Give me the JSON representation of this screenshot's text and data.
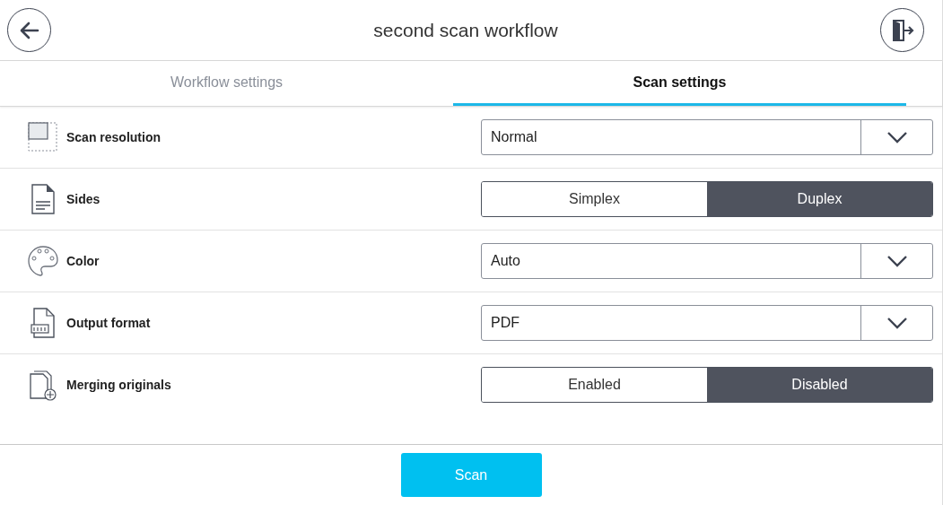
{
  "header": {
    "title": "second scan workflow"
  },
  "tabs": [
    {
      "label": "Workflow settings",
      "selected": false
    },
    {
      "label": "Scan settings",
      "selected": true
    }
  ],
  "settings": [
    {
      "label": "Scan resolution",
      "kind": "dropdown",
      "value": "Normal"
    },
    {
      "label": "Sides",
      "kind": "toggle",
      "options": [
        {
          "label": "Simplex",
          "selected": false
        },
        {
          "label": "Duplex",
          "selected": true
        }
      ]
    },
    {
      "label": "Color",
      "kind": "dropdown",
      "value": "Auto"
    },
    {
      "label": "Output format",
      "kind": "dropdown",
      "value": "PDF"
    },
    {
      "label": "Merging originals",
      "kind": "toggle",
      "options": [
        {
          "label": "Enabled",
          "selected": false
        },
        {
          "label": "Disabled",
          "selected": true
        }
      ]
    }
  ],
  "scan_button": "Scan"
}
